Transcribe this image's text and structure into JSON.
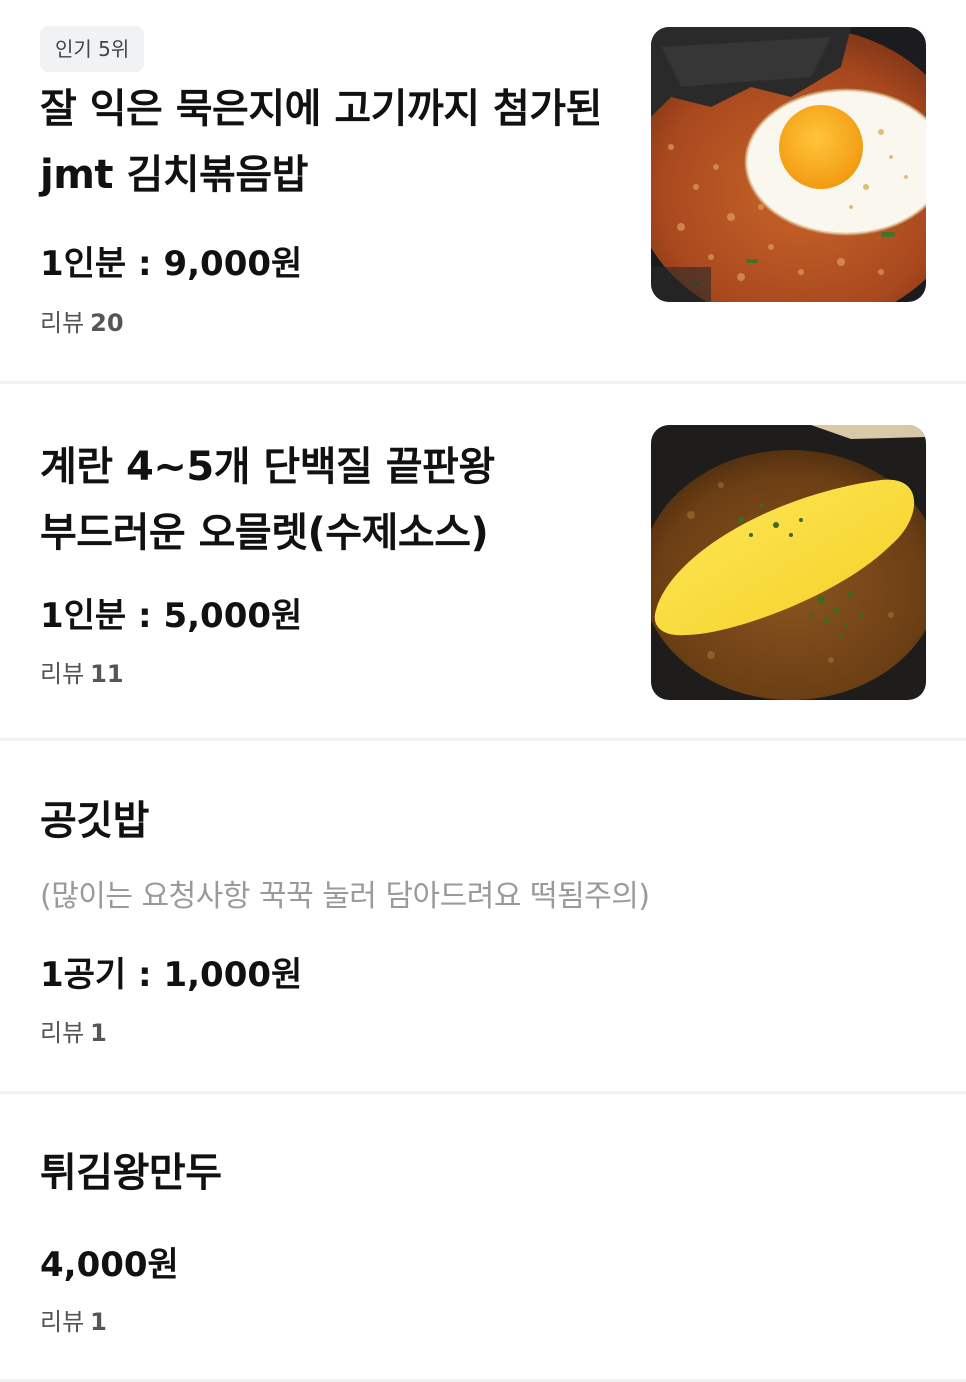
{
  "menu": [
    {
      "badge": "인기 5위",
      "title_lines": [
        "잘 익은 묵은지에 고기까지 첨가된",
        "jmt 김치볶음밥"
      ],
      "price": "1인분 : 9,000원",
      "review_label": "리뷰",
      "review_count": "20",
      "image_icon": "kimchi-fried-rice-photo"
    },
    {
      "title_lines": [
        "계란 4~5개 단백질 끝판왕",
        "부드러운 오믈렛(수제소스)"
      ],
      "price": "1인분 : 5,000원",
      "review_label": "리뷰",
      "review_count": "11",
      "image_icon": "omelette-curry-photo"
    },
    {
      "title_lines": [
        "공깃밥"
      ],
      "description": "(많이는 요청사항 꾹꾹 눌러 담아드려요 떡됨주의)",
      "price": "1공기 : 1,000원",
      "review_label": "리뷰",
      "review_count": "1"
    },
    {
      "title_lines": [
        "튀김왕만두"
      ],
      "price": "4,000원",
      "review_label": "리뷰",
      "review_count": "1"
    }
  ],
  "colors": {
    "badge_bg": "#f1f2f4",
    "divider": "#f2f2f2",
    "description": "#9a9a9a"
  }
}
